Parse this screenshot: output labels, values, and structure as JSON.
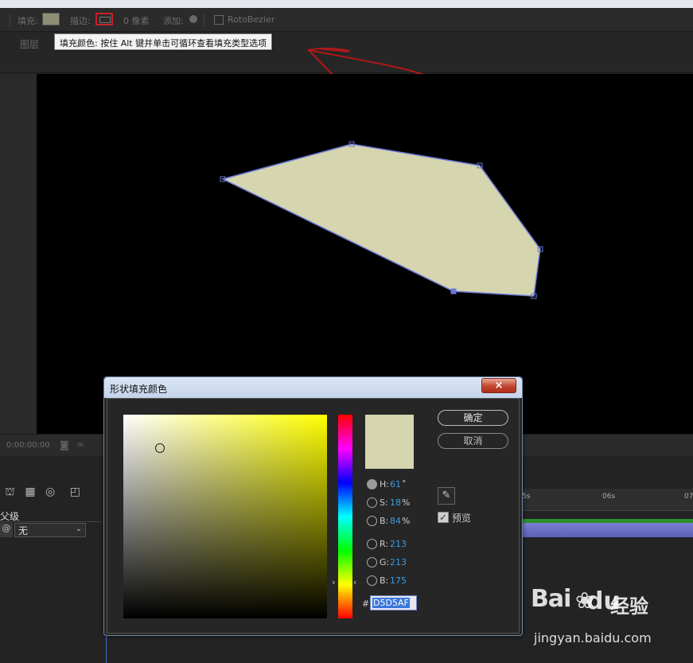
{
  "toolbar": {
    "fill_label": "填充:",
    "stroke_label": "描边:",
    "stroke_width": "0 像素",
    "add_label": "添加:",
    "rotobezier_label": "RotoBezier",
    "fill_color": "#8e8e77"
  },
  "panel": {
    "layer_label": "图层",
    "tooltip": "填充颜色: 按住 Alt 键并单击可循环查看填充类型选项"
  },
  "shape": {
    "fill_color": "#D5D5AF",
    "stroke_color": "#6b78d6"
  },
  "timeline": {
    "timecode": "0:00:00:00",
    "ruler_labels": [
      "5s",
      "06s",
      "07"
    ],
    "parent_header": "父级",
    "parent_value": "无",
    "layer_bar_color": "#6a70c6"
  },
  "dialog": {
    "title": "形状填充颜色",
    "close": "×",
    "ok": "确定",
    "cancel": "取消",
    "preview": "预览",
    "h_label": "H:",
    "h_value": "61",
    "h_unit": "°",
    "s_label": "S:",
    "s_value": "18",
    "s_unit": "%",
    "b_label": "B:",
    "b_value": "84",
    "b_unit": "%",
    "r_label": "R:",
    "r_value": "213",
    "g_label": "G:",
    "g_value": "213",
    "b2_label": "B:",
    "b2_value": "175",
    "hex_hash": "#",
    "hex_value": "D5D5AF",
    "current_color": "#D5D5AF"
  },
  "watermark": {
    "logo": "Bai",
    "logo_suffix": "du",
    "cn": "经验",
    "url": "jingyan.baidu.com"
  }
}
